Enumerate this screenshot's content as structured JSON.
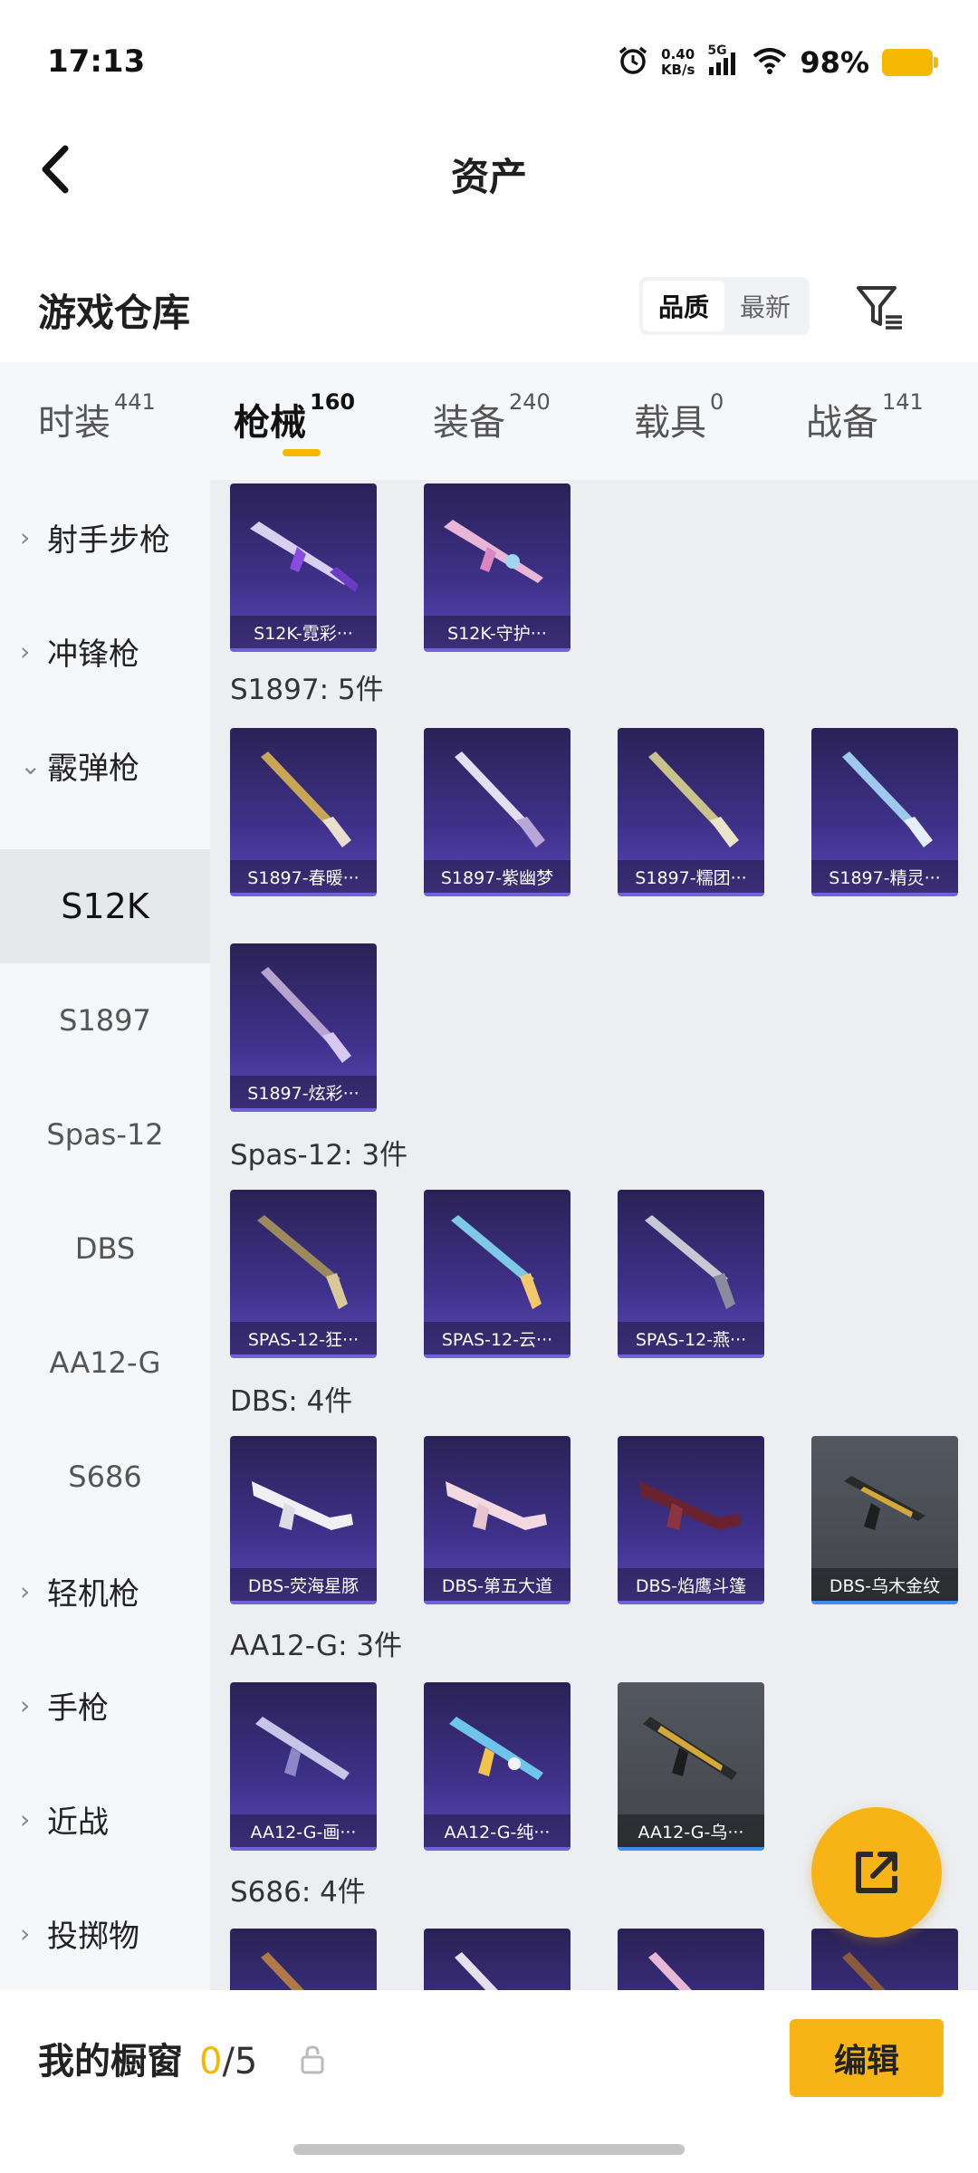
{
  "status_bar": {
    "time": "17:13",
    "net_speed_value": "0.40",
    "net_speed_unit": "KB/s",
    "network": "5G",
    "battery": "98%"
  },
  "header": {
    "title": "资产"
  },
  "repository": {
    "title": "游戏仓库",
    "sort_options": [
      "品质",
      "最新"
    ],
    "active_sort": "品质"
  },
  "tabs": [
    {
      "label": "时装",
      "count": "441"
    },
    {
      "label": "枪械",
      "count": "160",
      "active": true
    },
    {
      "label": "装备",
      "count": "240"
    },
    {
      "label": "载具",
      "count": "0"
    },
    {
      "label": "战备",
      "count": "141"
    }
  ],
  "sidebar": {
    "items": [
      {
        "label": "射手步枪",
        "type": "category",
        "expanded": false
      },
      {
        "label": "冲锋枪",
        "type": "category",
        "expanded": false
      },
      {
        "label": "霰弹枪",
        "type": "category",
        "expanded": true
      },
      {
        "label": "S12K",
        "type": "sub",
        "active": true
      },
      {
        "label": "S1897",
        "type": "sub"
      },
      {
        "label": "Spas-12",
        "type": "sub"
      },
      {
        "label": "DBS",
        "type": "sub"
      },
      {
        "label": "AA12-G",
        "type": "sub"
      },
      {
        "label": "S686",
        "type": "sub"
      },
      {
        "label": "轻机枪",
        "type": "category",
        "expanded": false
      },
      {
        "label": "手枪",
        "type": "category",
        "expanded": false
      },
      {
        "label": "近战",
        "type": "category",
        "expanded": false
      },
      {
        "label": "投掷物",
        "type": "category",
        "expanded": false
      }
    ]
  },
  "groups": [
    {
      "title": "",
      "items": [
        {
          "name": "S12K-霓彩···",
          "color": "purple"
        },
        {
          "name": "S12K-守护···",
          "color": "purple"
        }
      ]
    },
    {
      "title": "S1897: 5件",
      "items": [
        {
          "name": "S1897-春暖···",
          "color": "purple"
        },
        {
          "name": "S1897-紫幽梦",
          "color": "purple"
        },
        {
          "name": "S1897-糯团···",
          "color": "purple"
        },
        {
          "name": "S1897-精灵···",
          "color": "purple"
        },
        {
          "name": "S1897-炫彩···",
          "color": "purple"
        }
      ]
    },
    {
      "title": "Spas-12: 3件",
      "items": [
        {
          "name": "SPAS-12-狂···",
          "color": "purple"
        },
        {
          "name": "SPAS-12-云···",
          "color": "purple"
        },
        {
          "name": "SPAS-12-燕···",
          "color": "purple"
        }
      ]
    },
    {
      "title": "DBS: 4件",
      "items": [
        {
          "name": "DBS-荧海星豚",
          "color": "purple"
        },
        {
          "name": "DBS-第五大道",
          "color": "purple"
        },
        {
          "name": "DBS-焰鹰斗篷",
          "color": "purple"
        },
        {
          "name": "DBS-乌木金纹",
          "color": "grey"
        }
      ]
    },
    {
      "title": "AA12-G: 3件",
      "items": [
        {
          "name": "AA12-G-画···",
          "color": "purple"
        },
        {
          "name": "AA12-G-纯···",
          "color": "purple"
        },
        {
          "name": "AA12-G-乌···",
          "color": "grey"
        }
      ]
    },
    {
      "title": "S686: 4件",
      "items": [
        {
          "name": "",
          "color": "purple"
        },
        {
          "name": "",
          "color": "purple"
        },
        {
          "name": "",
          "color": "purple"
        },
        {
          "name": "",
          "color": "purple"
        }
      ]
    }
  ],
  "showcase": {
    "label": "我的橱窗",
    "current": "0",
    "separator_max": "/5"
  },
  "edit_button": "编辑",
  "colors": {
    "accent": "#f5b800",
    "card_purple": "#3f318a",
    "card_grey": "#4b4e55",
    "rare_border": "#6f63d8"
  },
  "icons": {
    "back": "chevron-left-icon",
    "filter": "filter-list-icon",
    "fab": "share-external-icon",
    "lock": "lock-icon"
  }
}
